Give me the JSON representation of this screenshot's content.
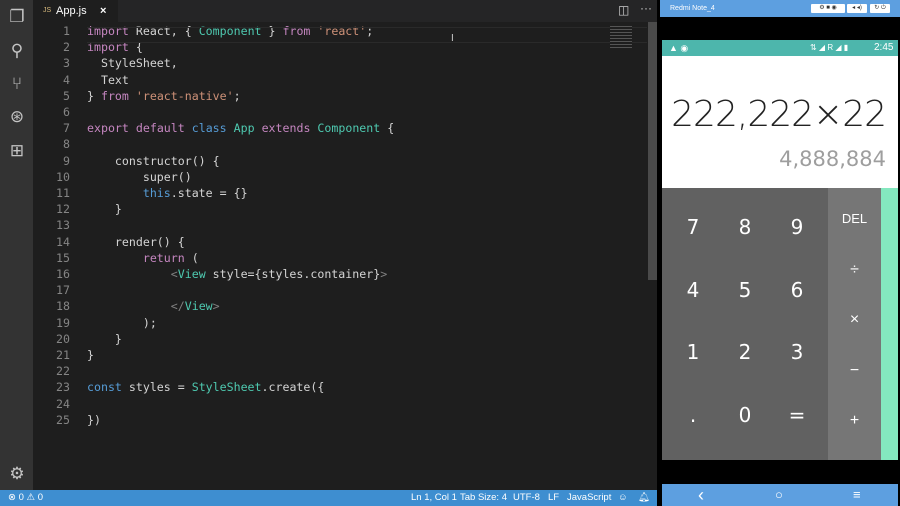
{
  "editor": {
    "tab": {
      "icon": "JS",
      "label": "App.js",
      "close": "×"
    },
    "lines": [
      [
        [
          "import",
          "k"
        ],
        [
          " React, { ",
          "p"
        ],
        [
          "Component",
          "t"
        ],
        [
          " } ",
          "p"
        ],
        [
          "from",
          "k"
        ],
        [
          " ",
          "p"
        ],
        [
          "'react'",
          "s"
        ],
        [
          ";",
          "p"
        ]
      ],
      [
        [
          "import",
          "k"
        ],
        [
          " {",
          "p"
        ]
      ],
      [
        [
          "  StyleSheet,",
          "p"
        ]
      ],
      [
        [
          "  Text",
          "p"
        ]
      ],
      [
        [
          "} ",
          "p"
        ],
        [
          "from",
          "k"
        ],
        [
          " ",
          "p"
        ],
        [
          "'react-native'",
          "s"
        ],
        [
          ";",
          "p"
        ]
      ],
      [],
      [
        [
          "export",
          "k"
        ],
        [
          " ",
          "p"
        ],
        [
          "default",
          "k"
        ],
        [
          " ",
          "p"
        ],
        [
          "class",
          "b"
        ],
        [
          " ",
          "p"
        ],
        [
          "App",
          "t"
        ],
        [
          " ",
          "p"
        ],
        [
          "extends",
          "k"
        ],
        [
          " ",
          "p"
        ],
        [
          "Component",
          "t"
        ],
        [
          " {",
          "p"
        ]
      ],
      [],
      [
        [
          "    constructor() {",
          "p"
        ]
      ],
      [
        [
          "        super()",
          "p"
        ]
      ],
      [
        [
          "        ",
          "p"
        ],
        [
          "this",
          "b"
        ],
        [
          ".state = {}",
          "p"
        ]
      ],
      [
        [
          "    }",
          "p"
        ]
      ],
      [],
      [
        [
          "    render() {",
          "p"
        ]
      ],
      [
        [
          "        ",
          "p"
        ],
        [
          "return",
          "k"
        ],
        [
          " (",
          "p"
        ]
      ],
      [
        [
          "            ",
          "p"
        ],
        [
          "<",
          "g"
        ],
        [
          "View",
          "t"
        ],
        [
          " style={styles.container}",
          "p"
        ],
        [
          ">",
          "g"
        ]
      ],
      [],
      [
        [
          "            ",
          "p"
        ],
        [
          "</",
          "g"
        ],
        [
          "View",
          "t"
        ],
        [
          ">",
          "g"
        ]
      ],
      [
        [
          "        );",
          "p"
        ]
      ],
      [
        [
          "    }",
          "p"
        ]
      ],
      [
        [
          "}",
          "p"
        ]
      ],
      [],
      [
        [
          "const",
          "b"
        ],
        [
          " styles = ",
          "p"
        ],
        [
          "StyleSheet",
          "t"
        ],
        [
          ".create({",
          "p"
        ]
      ],
      [],
      [
        [
          "})",
          "p"
        ]
      ]
    ]
  },
  "status": {
    "errors": "0",
    "warnings": "0",
    "position": "Ln 1, Col 1",
    "tab_size": "Tab Size: 4",
    "encoding": "UTF-8",
    "eol": "LF",
    "language": "JavaScript"
  },
  "phone": {
    "title": "Redmi Note_4",
    "time": "2:45",
    "network": "R",
    "expression": "222,222×22",
    "result": "4,888,884",
    "keys": [
      "7",
      "8",
      "9",
      "4",
      "5",
      "6",
      "1",
      "2",
      "3",
      ".",
      "0",
      "="
    ],
    "ops": [
      "DEL",
      "÷",
      "×",
      "−",
      "+"
    ],
    "nav": {
      "back": "‹",
      "home": "○",
      "menu": "≡"
    }
  },
  "colors": {
    "accent": "#3e8ed0",
    "keyword": "#c586c0",
    "type": "#4ec9b0",
    "string": "#ce9178",
    "calc_accent": "#84e8bf",
    "status_bar": "#4db6ac"
  }
}
